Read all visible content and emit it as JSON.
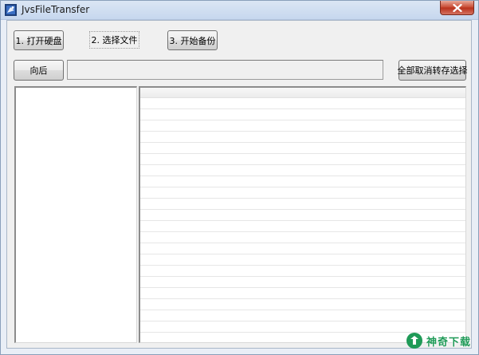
{
  "window": {
    "title": "JvsFileTransfer"
  },
  "toolbar": {
    "step1_label": "1. 打开硬盘",
    "step2_label": "2. 选择文件",
    "step3_label": "3. 开始备份",
    "back_label": "向后",
    "path_value": "",
    "cancel_all_label": "全部取消转存选择"
  },
  "watermark": {
    "text": "神奇下载"
  },
  "colors": {
    "close_button": "#c7472f",
    "watermark": "#1f9a57"
  }
}
